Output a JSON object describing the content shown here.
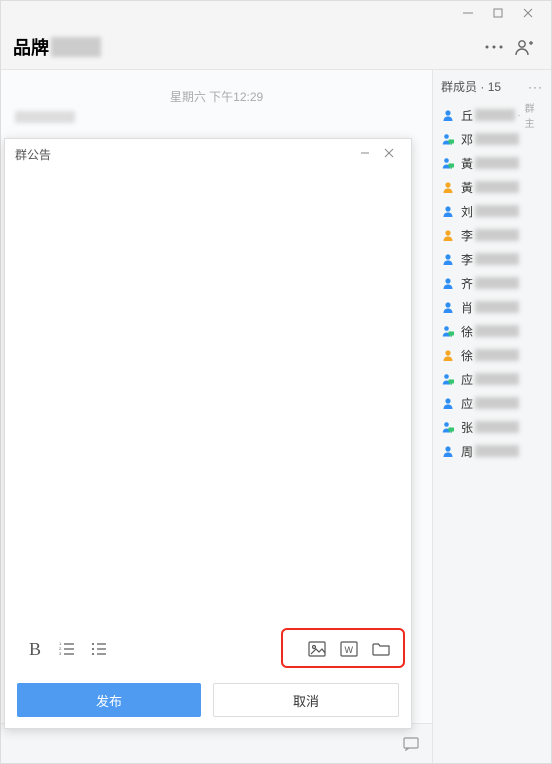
{
  "window": {
    "title_prefix": "品牌"
  },
  "chat": {
    "timestamp": "星期六 下午12:29"
  },
  "sidebar": {
    "header": "群成员",
    "count": "15",
    "owner_label": "群主",
    "members": [
      {
        "surname": "丘",
        "type": "blue",
        "owner": true
      },
      {
        "surname": "邓",
        "type": "screen"
      },
      {
        "surname": "黃",
        "type": "screen"
      },
      {
        "surname": "黃",
        "type": "orange"
      },
      {
        "surname": "刘",
        "type": "blue"
      },
      {
        "surname": "李",
        "type": "orange"
      },
      {
        "surname": "李",
        "type": "blue"
      },
      {
        "surname": "齐",
        "type": "blue"
      },
      {
        "surname": "肖",
        "type": "blue"
      },
      {
        "surname": "徐",
        "type": "screen"
      },
      {
        "surname": "徐",
        "type": "orange"
      },
      {
        "surname": "应",
        "type": "screen"
      },
      {
        "surname": "应",
        "type": "blue"
      },
      {
        "surname": "张",
        "type": "screen"
      },
      {
        "surname": "周",
        "type": "blue"
      }
    ]
  },
  "dialog": {
    "title": "群公告",
    "publish": "发布",
    "cancel": "取消"
  }
}
